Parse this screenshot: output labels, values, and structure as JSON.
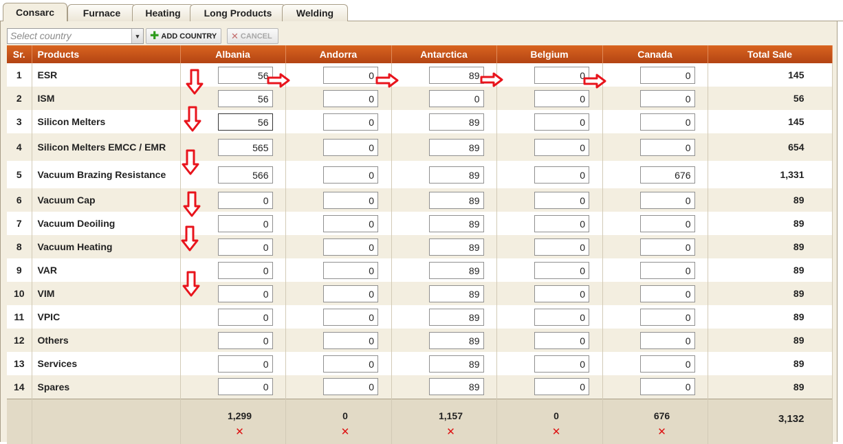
{
  "tabs": [
    {
      "label": "Consarc",
      "active": true
    },
    {
      "label": "Furnace",
      "active": false
    },
    {
      "label": "Heating",
      "active": false
    },
    {
      "label": "Long Products",
      "active": false
    },
    {
      "label": "Welding",
      "active": false
    }
  ],
  "toolbar": {
    "select_placeholder": "Select country",
    "add_label": "ADD COUNTRY",
    "cancel_label": "CANCEL"
  },
  "table": {
    "headers": {
      "sr": "Sr.",
      "products": "Products",
      "countries": [
        "Albania",
        "Andorra",
        "Antarctica",
        "Belgium",
        "Canada"
      ],
      "total": "Total Sale"
    },
    "rows": [
      {
        "sr": "1",
        "product": "ESR",
        "values": [
          "56",
          "0",
          "89",
          "0",
          "0"
        ],
        "total": "145"
      },
      {
        "sr": "2",
        "product": "ISM",
        "values": [
          "56",
          "0",
          "0",
          "0",
          "0"
        ],
        "total": "56"
      },
      {
        "sr": "3",
        "product": "Silicon Melters",
        "values": [
          "56",
          "0",
          "89",
          "0",
          "0"
        ],
        "total": "145"
      },
      {
        "sr": "4",
        "product": "Silicon Melters EMCC / EMR",
        "values": [
          "565",
          "0",
          "89",
          "0",
          "0"
        ],
        "total": "654"
      },
      {
        "sr": "5",
        "product": "Vacuum Brazing Resistance",
        "values": [
          "566",
          "0",
          "89",
          "0",
          "676"
        ],
        "total": "1,331"
      },
      {
        "sr": "6",
        "product": "Vacuum Cap",
        "values": [
          "0",
          "0",
          "89",
          "0",
          "0"
        ],
        "total": "89"
      },
      {
        "sr": "7",
        "product": "Vacuum Deoiling",
        "values": [
          "0",
          "0",
          "89",
          "0",
          "0"
        ],
        "total": "89"
      },
      {
        "sr": "8",
        "product": "Vacuum Heating",
        "values": [
          "0",
          "0",
          "89",
          "0",
          "0"
        ],
        "total": "89"
      },
      {
        "sr": "9",
        "product": "VAR",
        "values": [
          "0",
          "0",
          "89",
          "0",
          "0"
        ],
        "total": "89"
      },
      {
        "sr": "10",
        "product": "VIM",
        "values": [
          "0",
          "0",
          "89",
          "0",
          "0"
        ],
        "total": "89"
      },
      {
        "sr": "11",
        "product": "VPIC",
        "values": [
          "0",
          "0",
          "89",
          "0",
          "0"
        ],
        "total": "89"
      },
      {
        "sr": "12",
        "product": "Others",
        "values": [
          "0",
          "0",
          "89",
          "0",
          "0"
        ],
        "total": "89"
      },
      {
        "sr": "13",
        "product": "Services",
        "values": [
          "0",
          "0",
          "89",
          "0",
          "0"
        ],
        "total": "89"
      },
      {
        "sr": "14",
        "product": "Spares",
        "values": [
          "0",
          "0",
          "89",
          "0",
          "0"
        ],
        "total": "89"
      }
    ],
    "footer": {
      "sums": [
        "1,299",
        "0",
        "1,157",
        "0",
        "676"
      ],
      "remove_glyph": "✕",
      "grand_total": "3,132"
    }
  },
  "colors": {
    "header_top": "#d9641f",
    "header_bottom": "#b34413",
    "panel_bg": "#f3eee0",
    "arrow_red": "#e8141c"
  }
}
